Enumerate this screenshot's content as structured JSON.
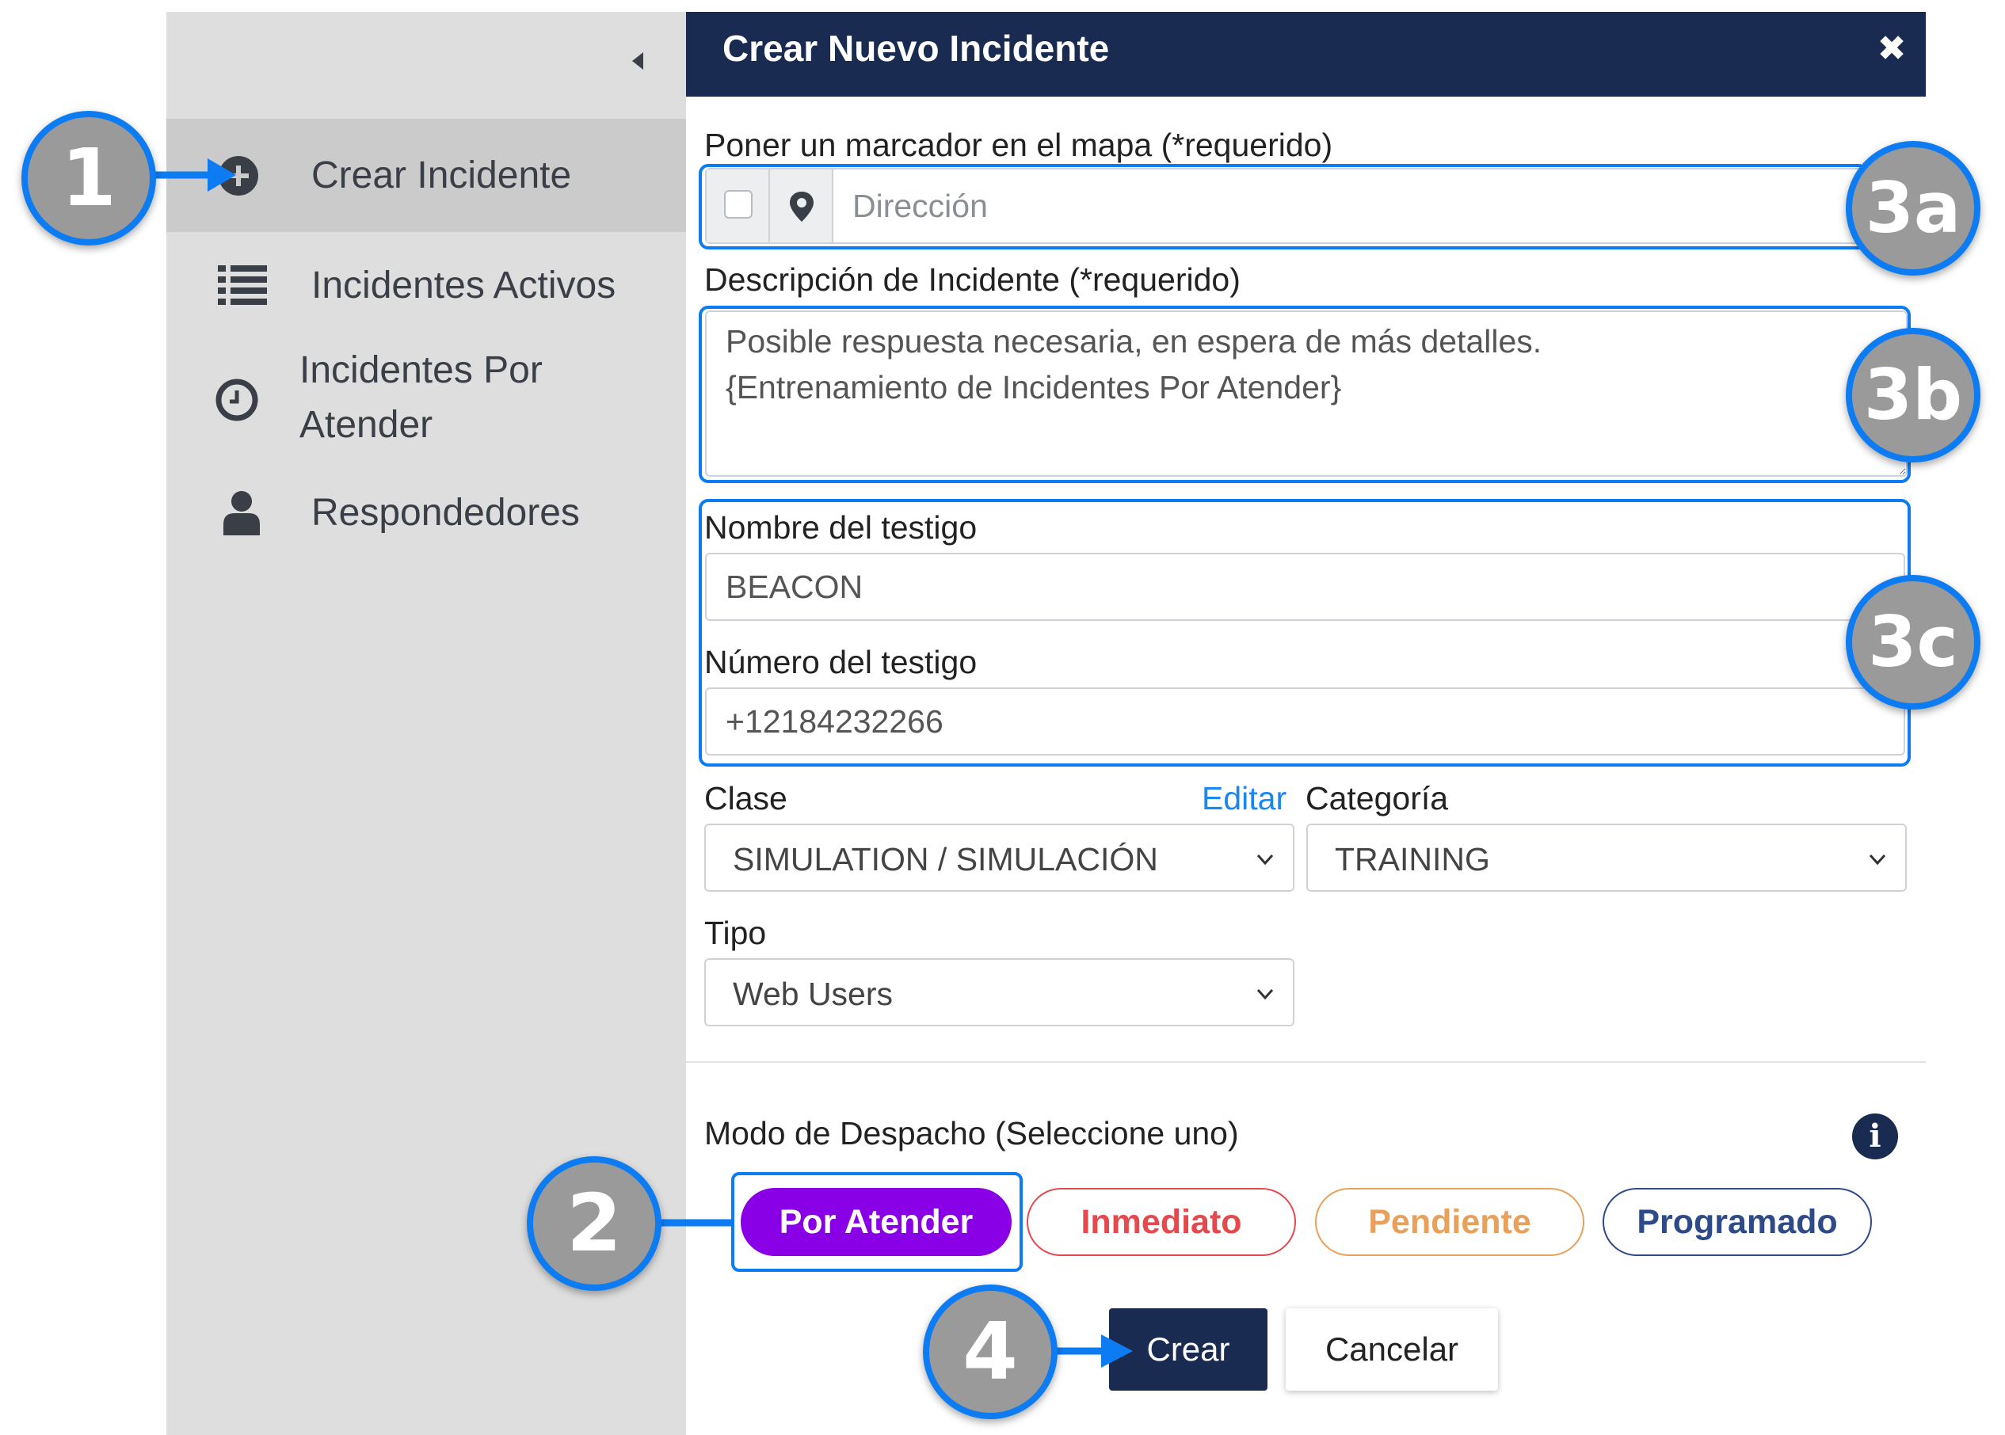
{
  "sidebar": {
    "collapse_icon": "caret-left-icon",
    "items": [
      {
        "label": "Crear Incidente",
        "icon": "plus-circle-icon"
      },
      {
        "label": "Incidentes Activos",
        "icon": "list-icon"
      },
      {
        "label_line1": "Incidentes Por",
        "label_line2": "Atender",
        "icon": "clock-icon"
      },
      {
        "label": "Respondedores",
        "icon": "user-icon"
      }
    ]
  },
  "dialog": {
    "title": "Crear Nuevo Incidente",
    "close_icon": "close-icon",
    "address": {
      "label": "Poner un marcador en el mapa (*requerido)",
      "placeholder": "Dirección"
    },
    "description": {
      "label": "Descripción de Incidente (*requerido)",
      "value": "Posible respuesta necesaria, en espera de más detalles.\n{Entrenamiento de Incidentes Por Atender}"
    },
    "witness_name": {
      "label": "Nombre del testigo",
      "value": "BEACON"
    },
    "witness_number": {
      "label": "Número del testigo",
      "value": "+12184232266"
    },
    "clase": {
      "label": "Clase",
      "edit_link": "Editar",
      "value": "SIMULATION / SIMULACIÓN"
    },
    "categoria": {
      "label": "Categoría",
      "value": "TRAINING"
    },
    "tipo": {
      "label": "Tipo",
      "value": "Web Users"
    },
    "dispatch": {
      "label": "Modo de Despacho (Seleccione uno)",
      "info_icon": "info-icon",
      "modes": [
        {
          "label": "Por Atender",
          "color": "#8a00e6",
          "selected": true
        },
        {
          "label": "Inmediato",
          "color": "#e5484d",
          "selected": false
        },
        {
          "label": "Pendiente",
          "color": "#e8a05a",
          "selected": false
        },
        {
          "label": "Programado",
          "color": "#2f4a88",
          "selected": false
        }
      ]
    },
    "actions": {
      "create": "Crear",
      "cancel": "Cancelar"
    }
  },
  "annotations": {
    "b1": "1",
    "b2": "2",
    "b3a": "3a",
    "b3b": "3b",
    "b3c": "3c",
    "b4": "4"
  },
  "colors": {
    "header": "#1a2b52",
    "highlight": "#0d7cf2",
    "sidebar": "#dedede",
    "link": "#1a86f0"
  }
}
